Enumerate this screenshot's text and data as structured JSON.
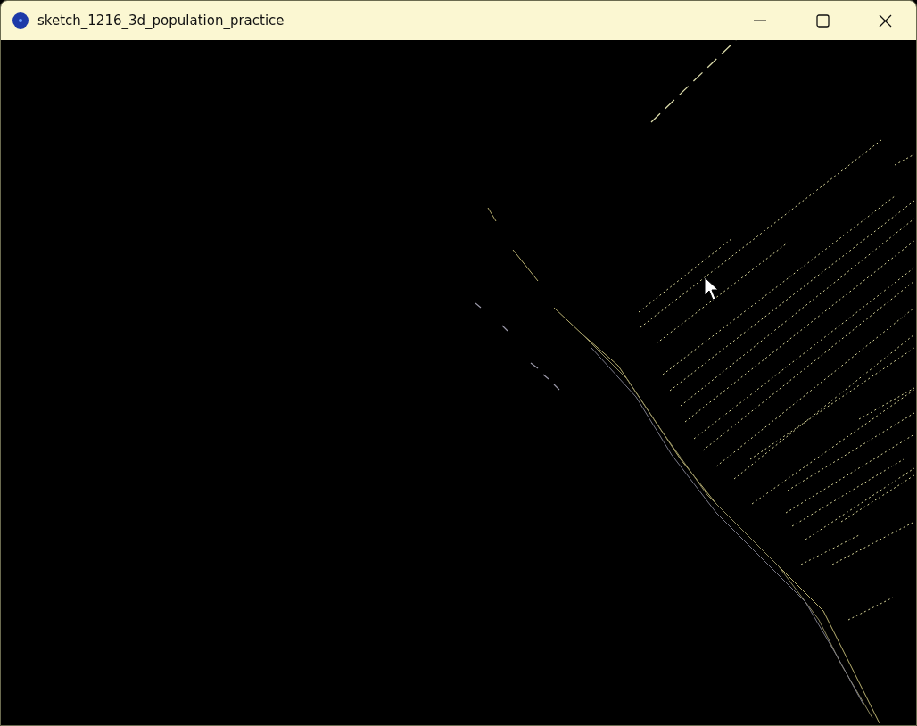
{
  "window": {
    "title": "sketch_1216_3d_population_practice"
  }
}
